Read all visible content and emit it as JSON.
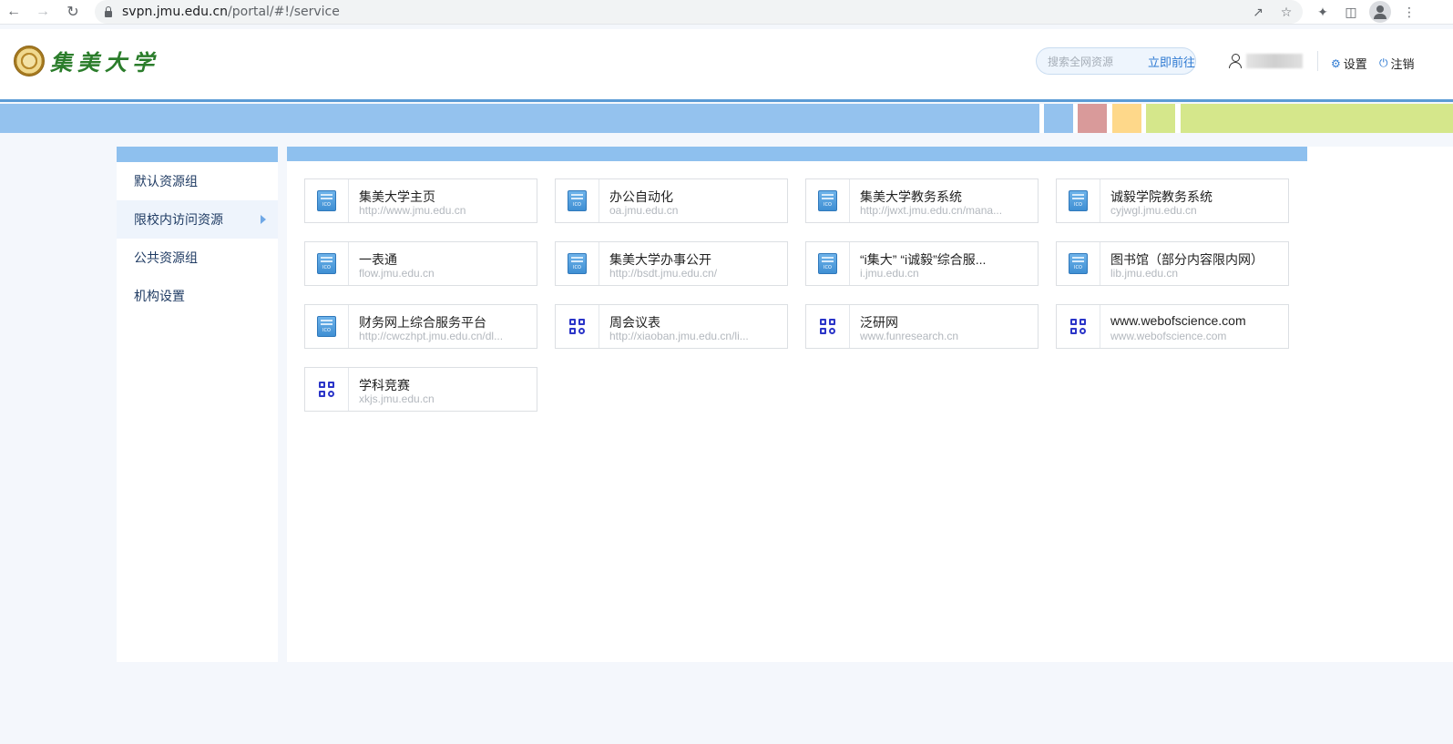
{
  "browser": {
    "url_host": "svpn.jmu.edu.cn",
    "url_path": "/portal/#!/service",
    "icons": [
      "back-icon",
      "forward-icon",
      "reload-icon",
      "lock-icon",
      "share-icon",
      "bookmark-star-icon",
      "extensions-icon",
      "sidepanel-icon",
      "profile-icon",
      "menu-dots-icon"
    ]
  },
  "header": {
    "logo_text": "集美大学",
    "search_placeholder": "搜索全网资源",
    "search_button": "立即前往",
    "settings_label": "设置",
    "logout_label": "注销"
  },
  "colors": {
    "accent": "#5b9bd5",
    "band_blue": "#94c2ee",
    "band_red": "#d99a9a",
    "band_orange": "#fed88a",
    "band_green": "#d5e78b"
  },
  "sidebar": {
    "items": [
      {
        "label": "默认资源组",
        "active": false
      },
      {
        "label": "限校内访问资源",
        "active": true
      },
      {
        "label": "公共资源组",
        "active": false
      },
      {
        "label": "机构设置",
        "active": false
      }
    ]
  },
  "resources": [
    {
      "title": "集美大学主页",
      "url": "http://www.jmu.edu.cn",
      "icon": "ico-file-icon"
    },
    {
      "title": "办公自动化",
      "url": "oa.jmu.edu.cn",
      "icon": "ico-file-icon"
    },
    {
      "title": "集美大学教务系统",
      "url": "http://jwxt.jmu.edu.cn/mana...",
      "icon": "ico-file-icon"
    },
    {
      "title": "诚毅学院教务系统",
      "url": "cyjwgl.jmu.edu.cn",
      "icon": "ico-file-icon"
    },
    {
      "title": "一表通",
      "url": "flow.jmu.edu.cn",
      "icon": "ico-file-icon"
    },
    {
      "title": "集美大学办事公开",
      "url": "http://bsdt.jmu.edu.cn/",
      "icon": "ico-file-icon"
    },
    {
      "title": "“i集大” “i诚毅”综合服...",
      "url": "i.jmu.edu.cn",
      "icon": "ico-file-icon"
    },
    {
      "title": "图书馆（部分内容限内网）",
      "url": "lib.jmu.edu.cn",
      "icon": "ico-file-icon"
    },
    {
      "title": "财务网上综合服务平台",
      "url": "http://cwczhpt.jmu.edu.cn/dl...",
      "icon": "ico-file-icon"
    },
    {
      "title": "周会议表",
      "url": "http://xiaoban.jmu.edu.cn/li...",
      "icon": "app-grid-icon"
    },
    {
      "title": "泛研网",
      "url": "www.funresearch.cn",
      "icon": "app-grid-icon"
    },
    {
      "title": "www.webofscience.com",
      "url": "www.webofscience.com",
      "icon": "app-grid-icon"
    },
    {
      "title": "学科竞赛",
      "url": "xkjs.jmu.edu.cn",
      "icon": "app-grid-icon"
    }
  ]
}
